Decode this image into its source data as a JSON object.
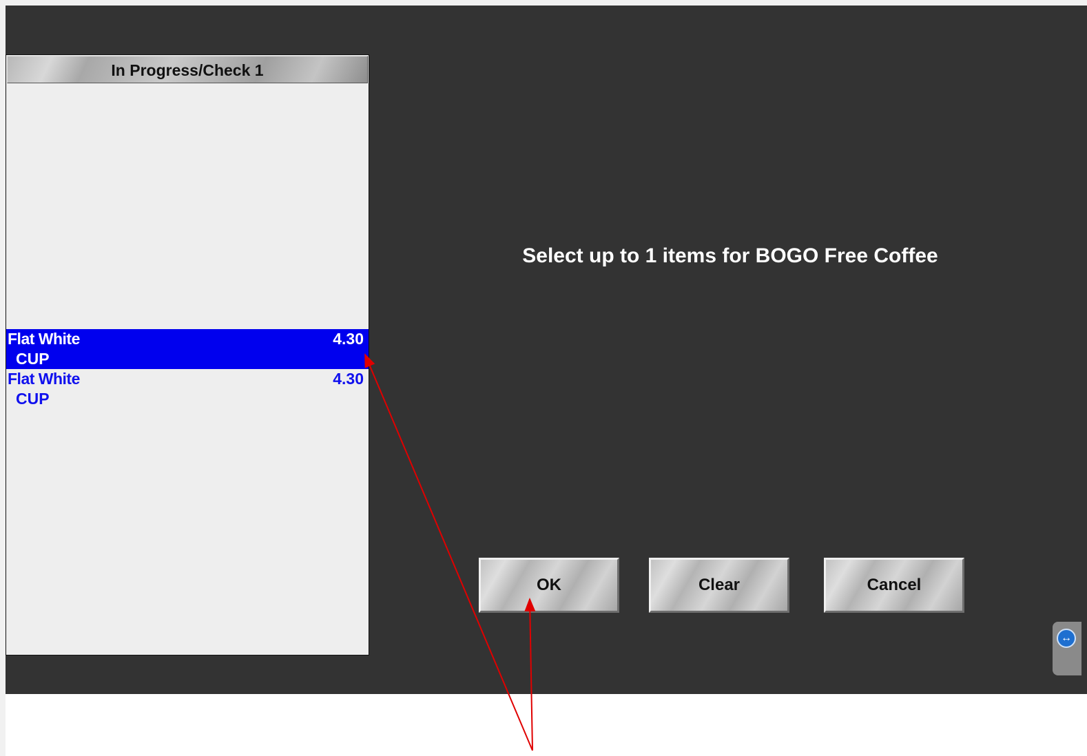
{
  "check": {
    "header": "In Progress/Check 1",
    "items": [
      {
        "name": "Flat White",
        "price": "4.30",
        "modifier": "CUP",
        "selected": true
      },
      {
        "name": "Flat White",
        "price": "4.30",
        "modifier": "CUP",
        "selected": false
      }
    ]
  },
  "prompt": "Select up to 1 items for BOGO Free Coffee",
  "buttons": {
    "ok": "OK",
    "clear": "Clear",
    "cancel": "Cancel"
  },
  "icons": {
    "remote": "teamviewer-icon"
  },
  "colors": {
    "screen": "#333333",
    "selected_row": "#0000ee",
    "item_text": "#1010ee",
    "annotation": "#e00000"
  }
}
